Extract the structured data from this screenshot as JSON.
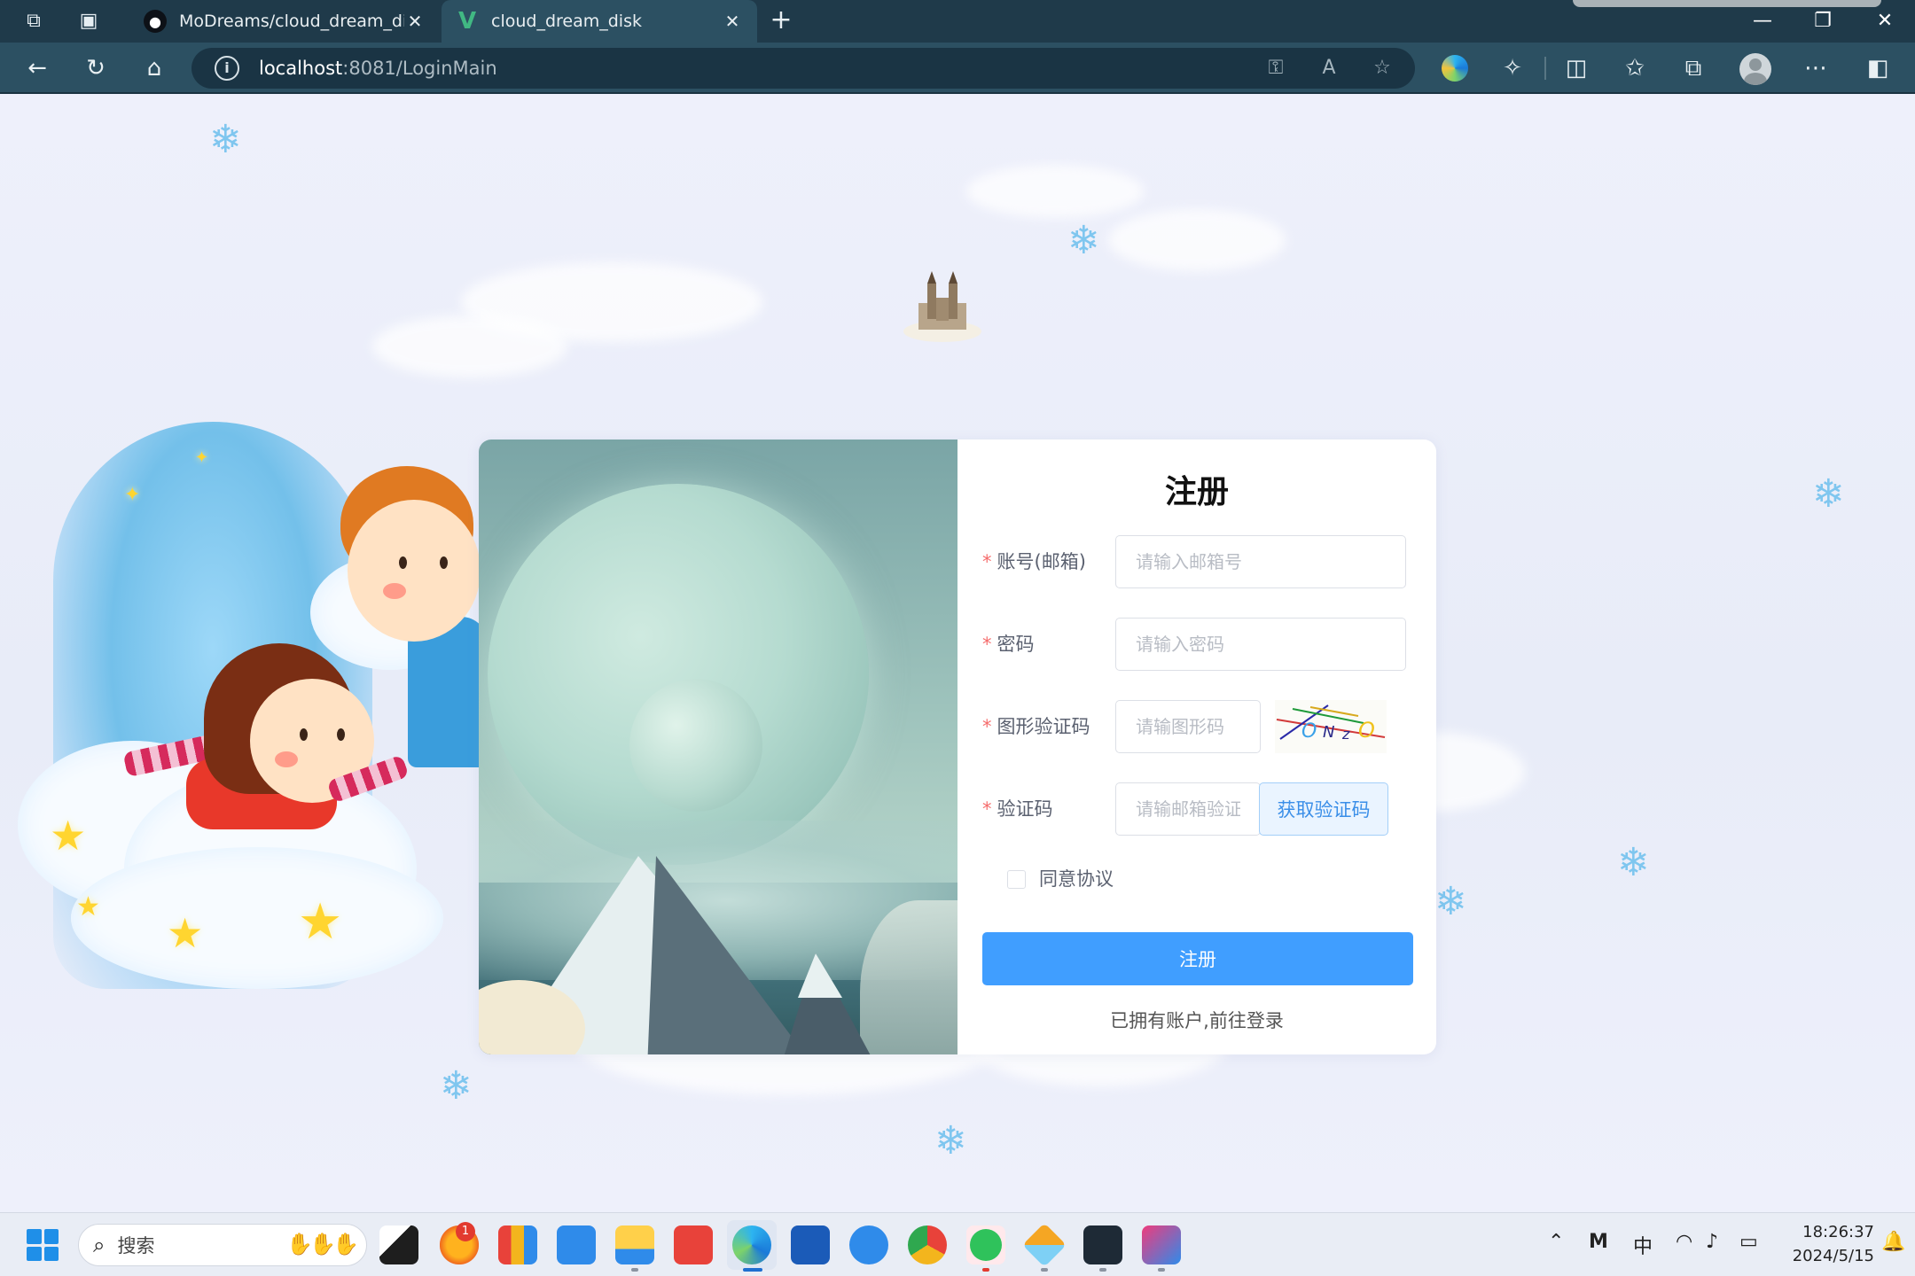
{
  "browser": {
    "tabs": [
      {
        "title": "MoDreams/cloud_dream_disk: —",
        "close": "✕"
      },
      {
        "title": "cloud_dream_disk",
        "close": "✕"
      }
    ],
    "new_tab": "+",
    "url_host": "localhost",
    "url_path": ":8081/LoginMain",
    "window_controls": {
      "minimize": "—",
      "restore": "❐",
      "close": "✕"
    }
  },
  "register": {
    "title": "注册",
    "fields": {
      "email": {
        "label": "账号(邮箱)",
        "placeholder": "请输入邮箱号"
      },
      "password": {
        "label": "密码",
        "placeholder": "请输入密码"
      },
      "captcha": {
        "label": "图形验证码",
        "placeholder": "请输图形码",
        "captcha_text": "ONzO"
      },
      "code": {
        "label": "验证码",
        "placeholder": "请输邮箱验证码",
        "button": "获取验证码"
      }
    },
    "required_mark": "*",
    "agree_label": "同意协议",
    "submit": "注册",
    "login_link": "已拥有账户,前往登录"
  },
  "taskbar": {
    "search_label": "搜索",
    "badge_count": "1",
    "ime": "中",
    "time": "18:26:37",
    "date": "2024/5/15"
  },
  "colors": {
    "primary": "#409eff",
    "required": "#f56c6c",
    "browser_frame": "#1f3a4a",
    "browser_toolbar": "#2c5062"
  }
}
